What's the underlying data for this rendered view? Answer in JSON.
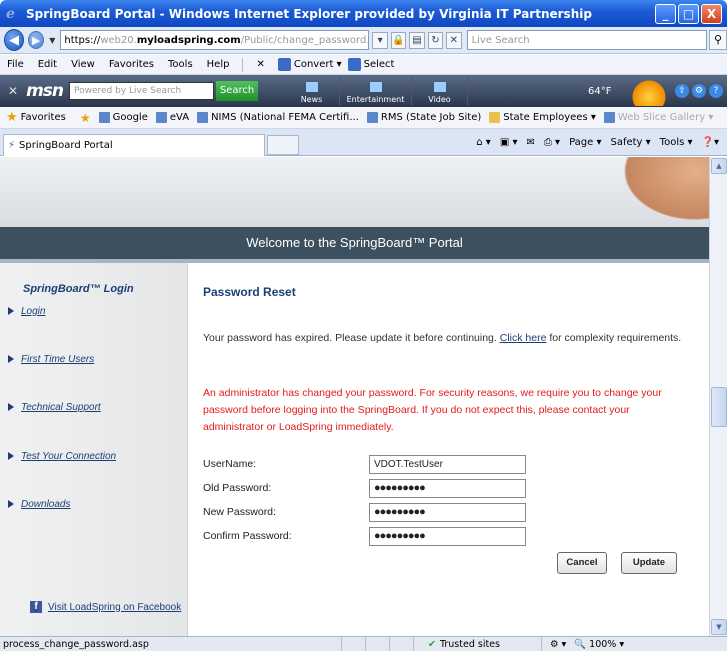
{
  "window": {
    "title": "SpringBoard Portal - Windows Internet Explorer provided by Virginia IT Partnership",
    "min_label": "_",
    "max_label": "□",
    "close_label": "X"
  },
  "address_bar": {
    "url_prefix": "https://",
    "url_sub": "web20.",
    "url_domain": "myloadspring.com",
    "url_path": "/Public/change_password.asp",
    "live_search_placeholder": "Live Search"
  },
  "menu": {
    "items": [
      "File",
      "Edit",
      "View",
      "Favorites",
      "Tools",
      "Help"
    ],
    "convert_label": "Convert",
    "select_label": "Select"
  },
  "msn": {
    "logo": "msn",
    "search_placeholder": "Powered by Live Search",
    "search_button": "Search",
    "nav": [
      "News",
      "Entertainment",
      "Video"
    ],
    "temperature": "64°F"
  },
  "favorites": {
    "label": "Favorites",
    "items": [
      "Google",
      "eVA",
      "NIMS (National FEMA Certifi...",
      "RMS (State Job Site)",
      "State Employees ▾",
      "Web Slice Gallery ▾"
    ]
  },
  "tab": {
    "title": "SpringBoard Portal",
    "page_label": "Page ▾",
    "safety_label": "Safety ▾",
    "tools_label": "Tools ▾"
  },
  "page": {
    "banner": "Welcome to the SpringBoard™ Portal",
    "sidebar": {
      "title": "SpringBoard™ Login",
      "items": [
        "Login",
        "First Time Users",
        "Technical Support",
        "Test Your Connection",
        "Downloads"
      ],
      "facebook": "Visit LoadSpring on Facebook"
    },
    "title": "Password Reset",
    "info_before": "Your password has expired. Please update it before continuing.",
    "info_link": "Click here",
    "info_after": "for complexity requirements.",
    "warning": "An administrator has changed your password. For security reasons, we require you to change your password before logging into the SpringBoard. If you do not expect this, please contact your administrator or LoadSpring immediately.",
    "form": {
      "username_label": "UserName:",
      "username_value": "VDOT.TestUser",
      "old_label": "Old Password:",
      "old_value": "●●●●●●●●●",
      "new_label": "New Password:",
      "new_value": "●●●●●●●●●",
      "confirm_label": "Confirm Password:",
      "confirm_value": "●●●●●●●●●",
      "cancel": "Cancel",
      "update": "Update"
    }
  },
  "status": {
    "text": "process_change_password.asp",
    "zone": "Trusted sites",
    "zoom": "100%"
  }
}
